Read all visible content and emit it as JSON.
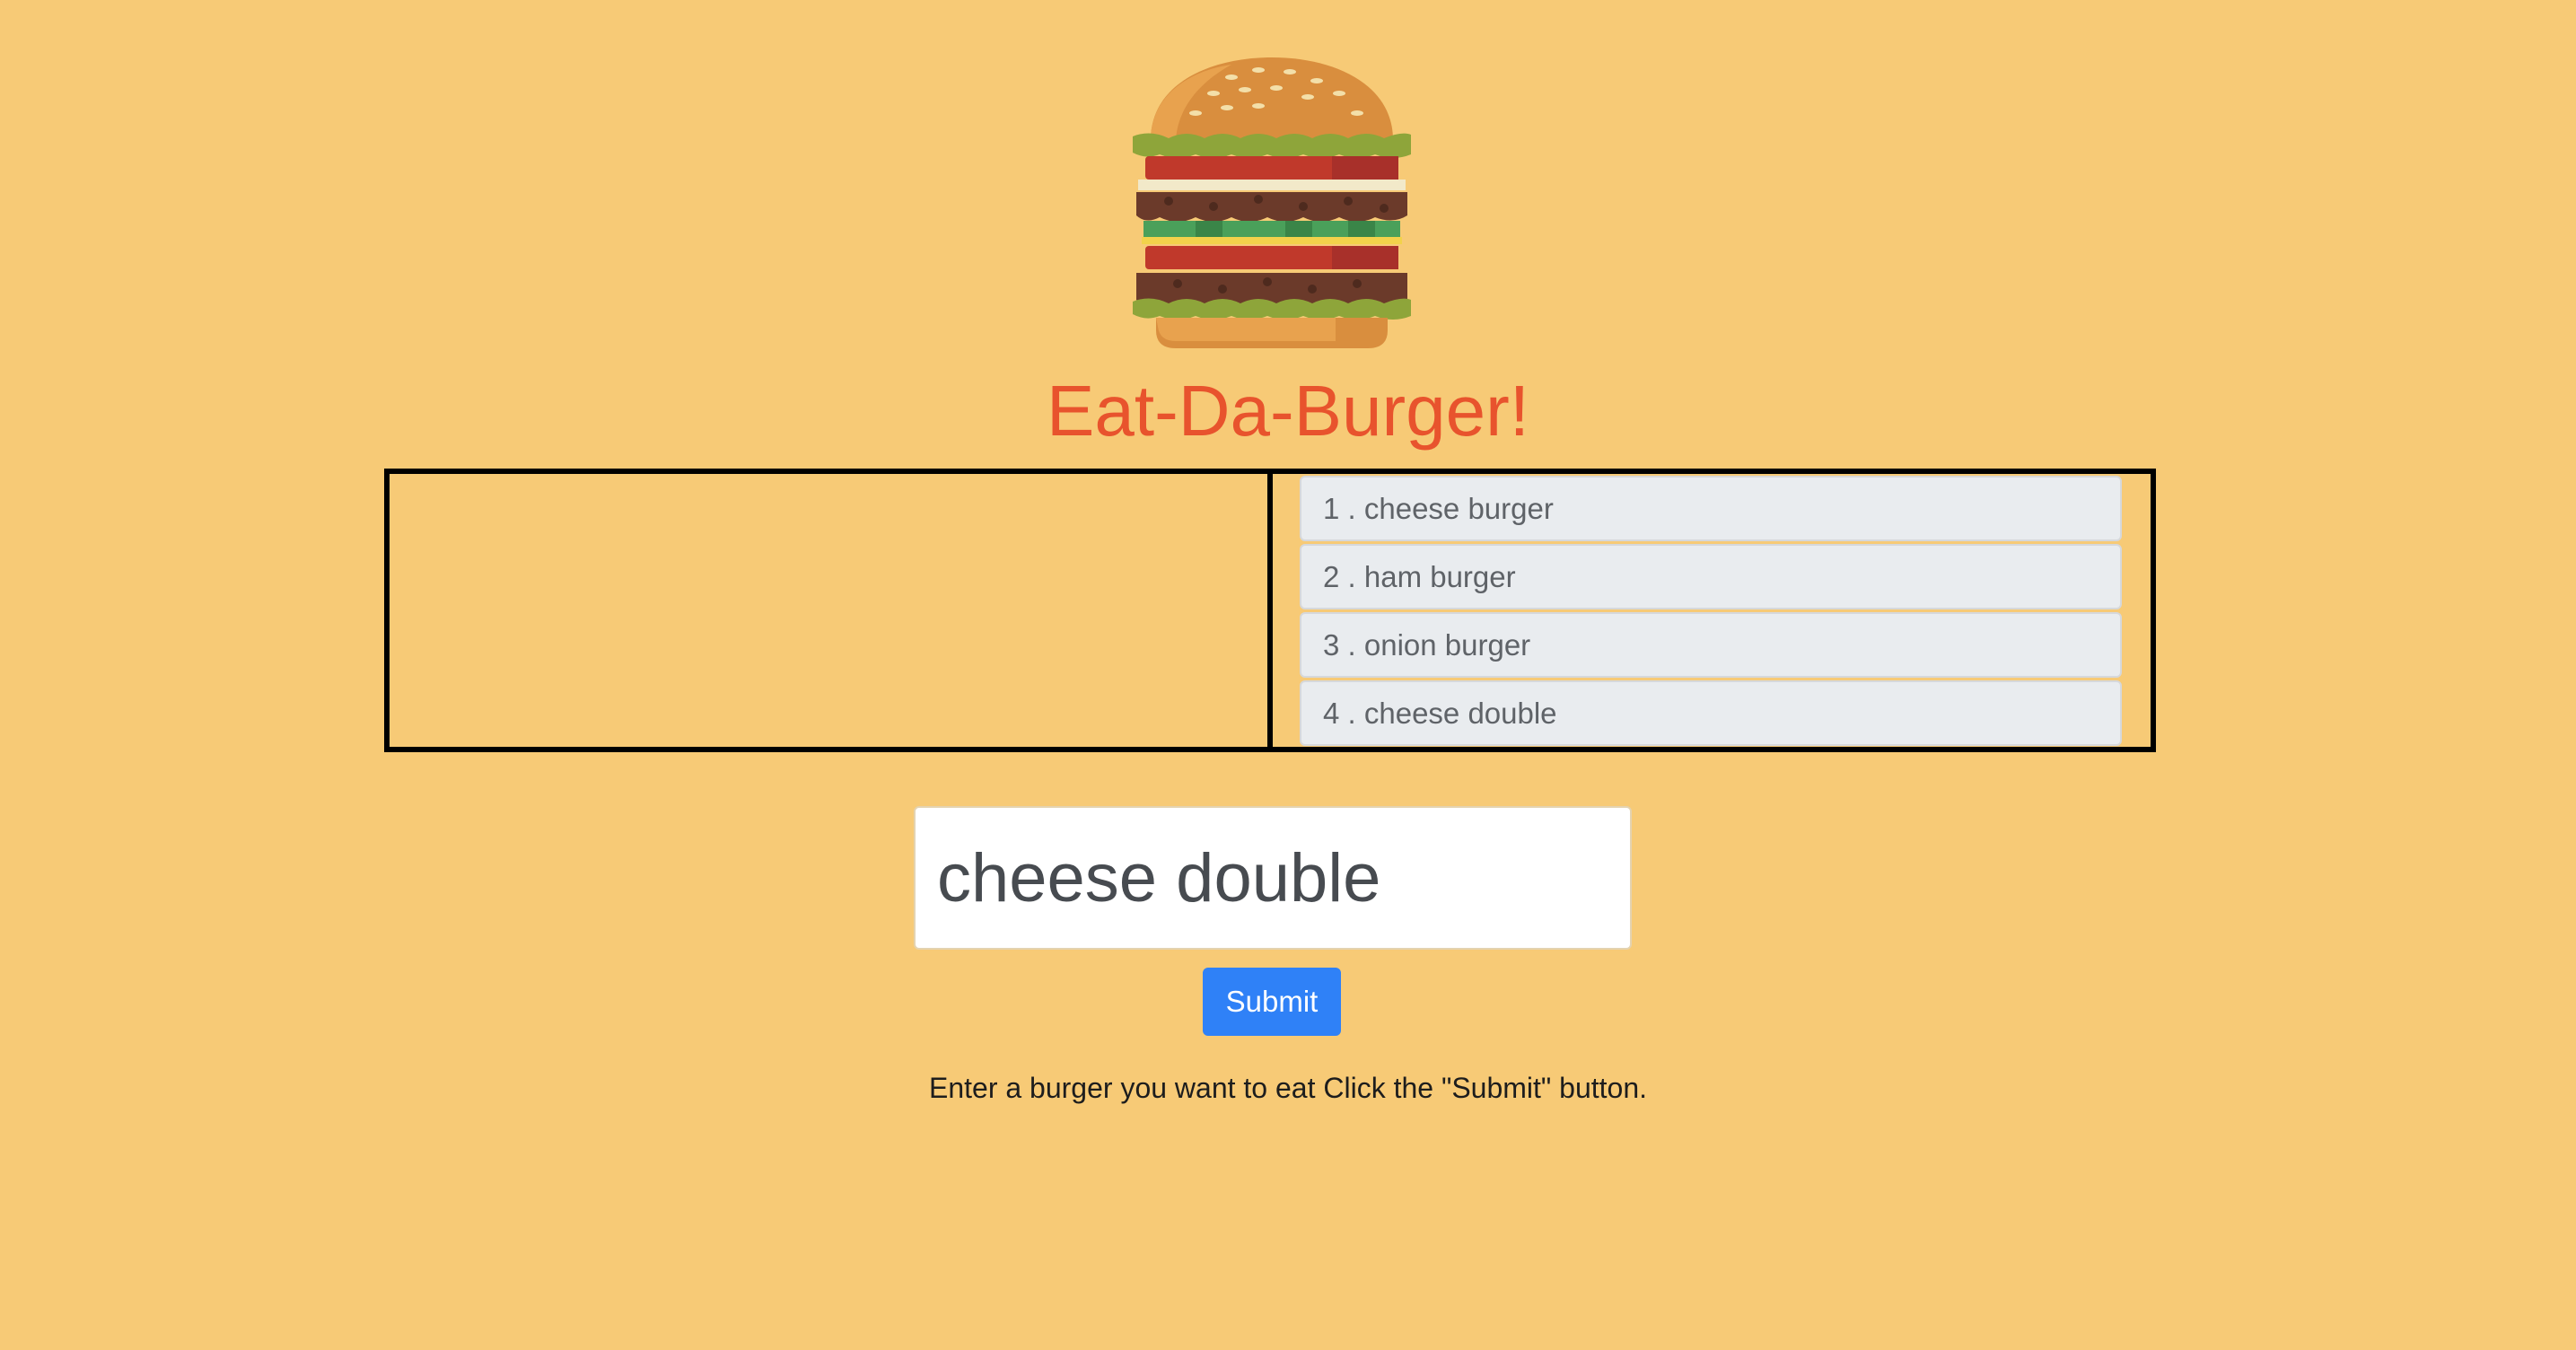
{
  "header": {
    "title": "Eat-Da-Burger!",
    "logo_icon": "burger-icon"
  },
  "eaten_panel": {
    "items": []
  },
  "uneaten_panel": {
    "items": [
      {
        "label": "1 . cheese burger"
      },
      {
        "label": "2 . ham burger"
      },
      {
        "label": "3 . onion burger"
      },
      {
        "label": "4 . cheese double"
      }
    ]
  },
  "form": {
    "input_value": "cheese double",
    "submit_label": "Submit",
    "instructions": "Enter a burger you want to eat Click the \"Submit\" button."
  },
  "colors": {
    "background": "#f7ca76",
    "title": "#e8532d",
    "button": "#2f81f7",
    "list_item_bg": "#e9ecef"
  }
}
